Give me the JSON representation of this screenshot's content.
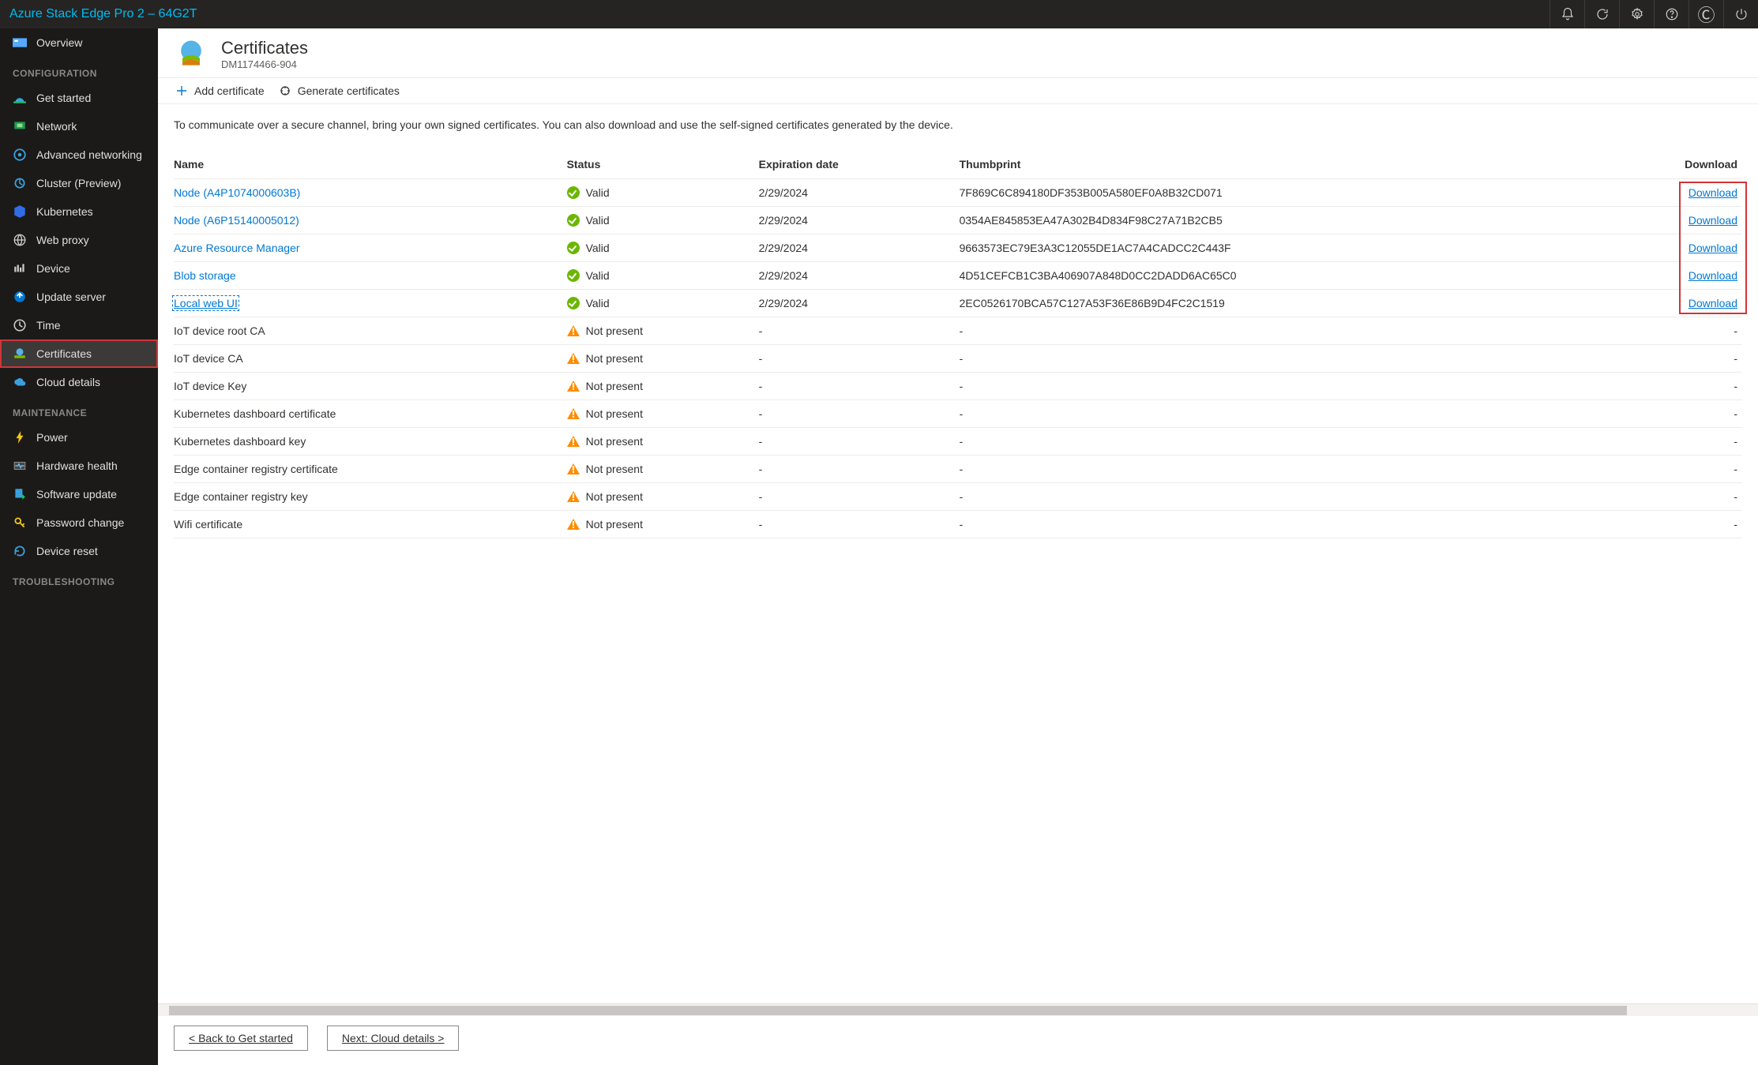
{
  "header": {
    "title": "Azure Stack Edge Pro 2 – 64G2T"
  },
  "sidebar": {
    "overview": "Overview",
    "sections": {
      "configuration": {
        "label": "CONFIGURATION",
        "items": [
          {
            "label": "Get started"
          },
          {
            "label": "Network"
          },
          {
            "label": "Advanced networking"
          },
          {
            "label": "Cluster (Preview)"
          },
          {
            "label": "Kubernetes"
          },
          {
            "label": "Web proxy"
          },
          {
            "label": "Device"
          },
          {
            "label": "Update server"
          },
          {
            "label": "Time"
          },
          {
            "label": "Certificates"
          },
          {
            "label": "Cloud details"
          }
        ]
      },
      "maintenance": {
        "label": "MAINTENANCE",
        "items": [
          {
            "label": "Power"
          },
          {
            "label": "Hardware health"
          },
          {
            "label": "Software update"
          },
          {
            "label": "Password change"
          },
          {
            "label": "Device reset"
          }
        ]
      },
      "troubleshooting": {
        "label": "TROUBLESHOOTING"
      }
    }
  },
  "page": {
    "title": "Certificates",
    "subtitle": "DM1174466-904",
    "toolbar": {
      "add": "Add certificate",
      "generate": "Generate certificates"
    },
    "description": "To communicate over a secure channel, bring your own signed certificates. You can also download and use the self-signed certificates generated by the device.",
    "columns": {
      "name": "Name",
      "status": "Status",
      "exp": "Expiration date",
      "thumb": "Thumbprint",
      "download": "Download"
    },
    "status_labels": {
      "valid": "Valid",
      "not_present": "Not present"
    },
    "download_label": "Download",
    "dash": "-",
    "rows": [
      {
        "name": "Node (A4P1074000603B)",
        "status": "valid",
        "exp": "2/29/2024",
        "thumb": "7F869C6C894180DF353B005A580EF0A8B32CD071",
        "dl": true,
        "link": true
      },
      {
        "name": "Node (A6P15140005012)",
        "status": "valid",
        "exp": "2/29/2024",
        "thumb": "0354AE845853EA47A302B4D834F98C27A71B2CB5",
        "dl": true,
        "link": true
      },
      {
        "name": "Azure Resource Manager",
        "status": "valid",
        "exp": "2/29/2024",
        "thumb": "9663573EC79E3A3C12055DE1AC7A4CADCC2C443F",
        "dl": true,
        "link": true
      },
      {
        "name": "Blob storage",
        "status": "valid",
        "exp": "2/29/2024",
        "thumb": "4D51CEFCB1C3BA406907A848D0CC2DADD6AC65C0",
        "dl": true,
        "link": true
      },
      {
        "name": "Local web UI",
        "status": "valid",
        "exp": "2/29/2024",
        "thumb": "2EC0526170BCA57C127A53F36E86B9D4FC2C1519",
        "dl": true,
        "link": true,
        "focused": true
      },
      {
        "name": "IoT device root CA",
        "status": "not_present"
      },
      {
        "name": "IoT device CA",
        "status": "not_present"
      },
      {
        "name": "IoT device Key",
        "status": "not_present"
      },
      {
        "name": "Kubernetes dashboard certificate",
        "status": "not_present"
      },
      {
        "name": "Kubernetes dashboard key",
        "status": "not_present"
      },
      {
        "name": "Edge container registry certificate",
        "status": "not_present"
      },
      {
        "name": "Edge container registry key",
        "status": "not_present"
      },
      {
        "name": "Wifi certificate",
        "status": "not_present"
      }
    ]
  },
  "footer": {
    "back": "< Back to Get started",
    "next": "Next: Cloud details >"
  }
}
